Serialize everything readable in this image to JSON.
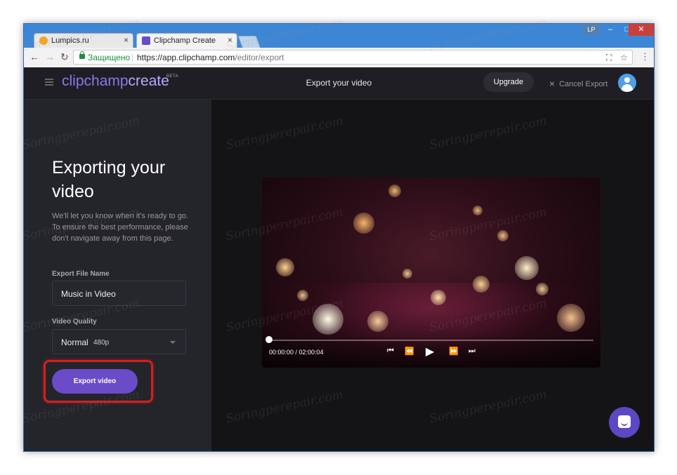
{
  "browser": {
    "tabs": [
      {
        "title": "Lumpics.ru",
        "close": "×"
      },
      {
        "title": "Clipchamp Create",
        "close": "×"
      }
    ],
    "window_badge": "LP",
    "window_controls": {
      "minimize": "–",
      "maximize": "□",
      "close": "✕"
    },
    "nav": {
      "back": "←",
      "forward": "→",
      "reload": "↻"
    },
    "address": {
      "secure_label": "Защищено",
      "url_main": "https://app.clipchamp.com",
      "url_path": "/editor/export"
    }
  },
  "app": {
    "logo": {
      "part1": "clipchamp",
      "part2": "create",
      "badge": "BETA"
    },
    "header_title": "Export your video",
    "upgrade_label": "Upgrade",
    "cancel_label": "Cancel Export",
    "cancel_icon": "×"
  },
  "sidebar": {
    "heading": "Exporting your video",
    "message": "We'll let you know when it's ready to go.\nTo ensure the best performance, please don't navigate away from this page.",
    "file_name_label": "Export File Name",
    "file_name_value": "Music in Video",
    "quality_label": "Video Quality",
    "quality_value": "Normal",
    "quality_res": "480p",
    "export_button": "Export video"
  },
  "player": {
    "time": "00:00:00 / 02:00:04",
    "progress": 0,
    "controls": {
      "skip_start": "⏮",
      "rewind": "⏪",
      "play": "▶",
      "fast_forward": "⏩",
      "skip_end": "⏭"
    }
  },
  "watermark": "Soringperepair.com",
  "colors": {
    "accent": "#6a4bc8",
    "highlight": "#d0211f",
    "browser_frame": "#3d86d6"
  }
}
